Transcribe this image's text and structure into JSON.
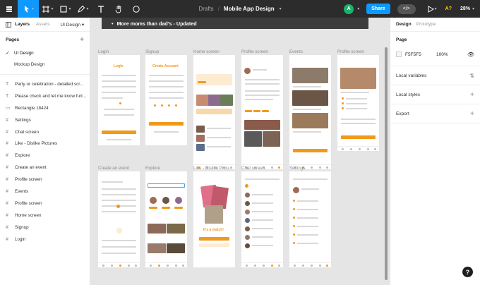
{
  "toolbar": {
    "breadcrumb_drafts": "Drafts",
    "breadcrumb_sep": "/",
    "file_name": "Mobile App Design",
    "avatar_letter": "A",
    "share_label": "Share",
    "aa_label": "A?",
    "zoom_label": "28%"
  },
  "left_panel": {
    "tabs": [
      "Layers",
      "Assets"
    ],
    "design_dropdown": "UI Design",
    "pages_label": "Pages",
    "pages": [
      "UI Design",
      "Mockup Design"
    ],
    "layers": [
      "Party or celebration - detailed scr...",
      "Please check and let me know furt...",
      "Rectangle 18424",
      "Settings",
      "Chat screen",
      "Like - Dislike Pictures",
      "Explore",
      "Create an event",
      "Profile screen",
      "Events",
      "Profile screen",
      "Home screen",
      "Signup",
      "Login"
    ]
  },
  "canvas": {
    "banner": "More moms than dad's - Updated",
    "frames_row1": [
      "Login",
      "Signup",
      "Home screen",
      "Profile screen",
      "Events",
      "Profile screen"
    ],
    "frames_row2": [
      "Create an event",
      "Explore",
      "Like - Dislike Pictu...",
      "Chat screen",
      "Settings"
    ],
    "login_title": "Login",
    "signup_title": "Create Account",
    "match_text": "It's a match!"
  },
  "right_panel": {
    "tabs": [
      "Design",
      "Prototype"
    ],
    "page_label": "Page",
    "bg_hex": "F5F5F5",
    "bg_opacity": "100%",
    "local_variables": "Local variables",
    "local_styles": "Local styles",
    "export": "Export"
  },
  "colors": {
    "accent_blue": "#0d99ff",
    "app_orange": "#f09a1a",
    "toolbar_bg": "#2c2c2c"
  },
  "help_label": "?"
}
